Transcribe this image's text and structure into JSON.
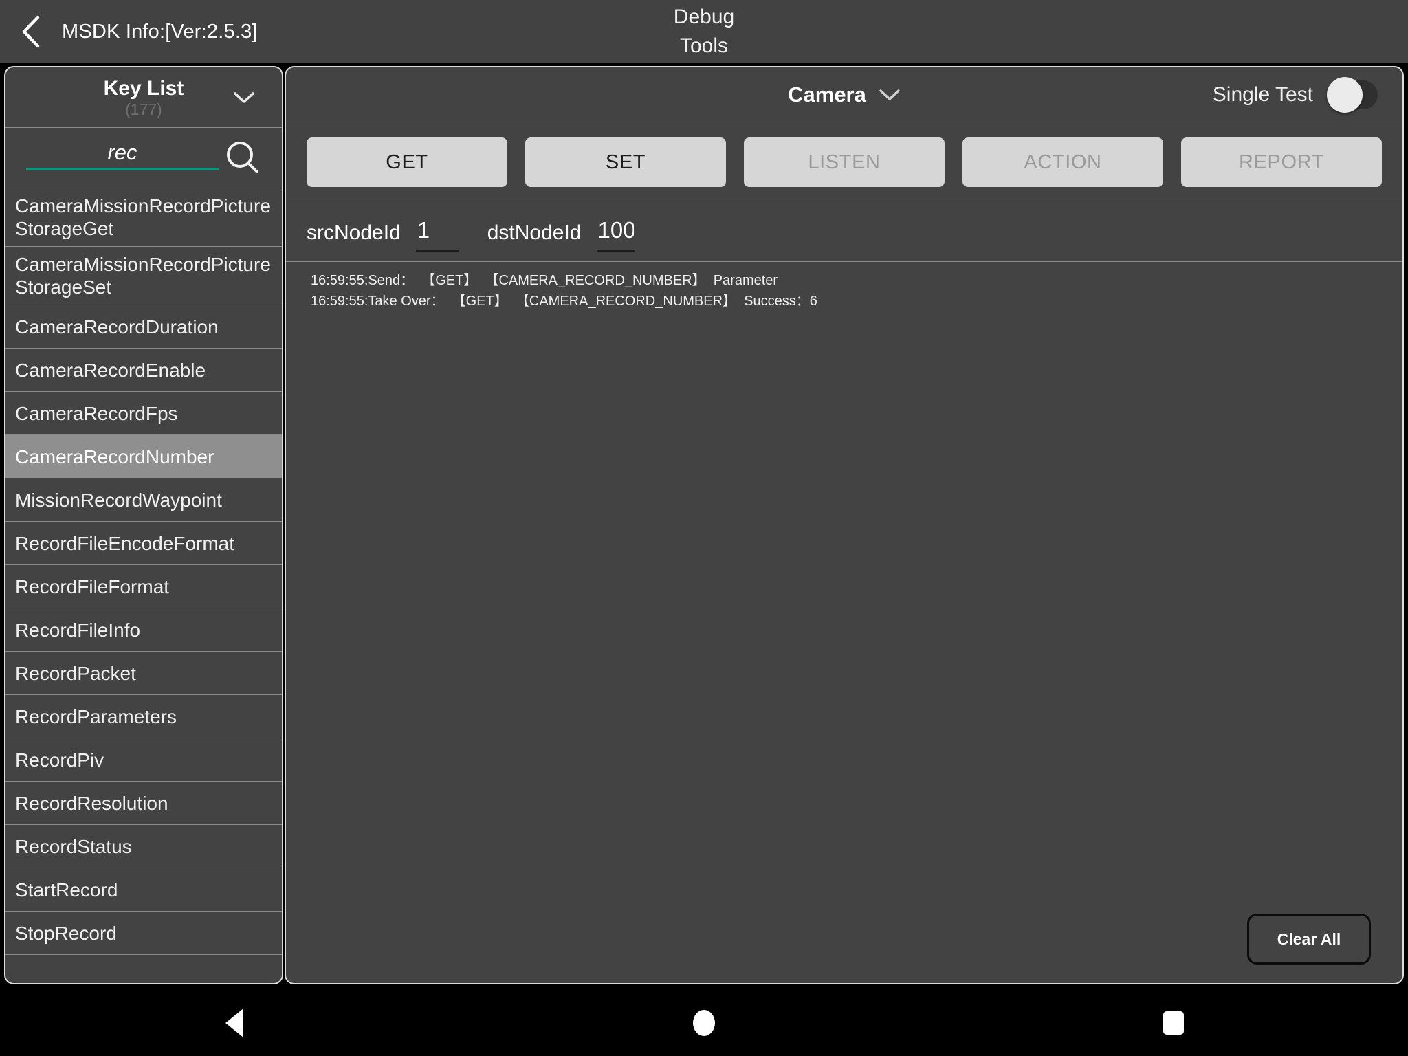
{
  "header": {
    "back_icon": "chevron-left-icon",
    "left_title": "MSDK Info:[Ver:2.5.3]",
    "title_line1": "Debug",
    "title_line2": "Tools"
  },
  "sidebar": {
    "title": "Key List",
    "count": "(177)",
    "caret_icon": "chevron-down-icon",
    "search": {
      "value": "rec",
      "placeholder": "",
      "icon": "search-icon",
      "underline_color": "#13927e"
    },
    "items": [
      {
        "label": "CameraMissionRecordPictureStorageGet",
        "selected": false
      },
      {
        "label": "CameraMissionRecordPictureStorageSet",
        "selected": false
      },
      {
        "label": "CameraRecordDuration",
        "selected": false
      },
      {
        "label": "CameraRecordEnable",
        "selected": false
      },
      {
        "label": "CameraRecordFps",
        "selected": false
      },
      {
        "label": "CameraRecordNumber",
        "selected": true
      },
      {
        "label": "MissionRecordWaypoint",
        "selected": false
      },
      {
        "label": "RecordFileEncodeFormat",
        "selected": false
      },
      {
        "label": "RecordFileFormat",
        "selected": false
      },
      {
        "label": "RecordFileInfo",
        "selected": false
      },
      {
        "label": "RecordPacket",
        "selected": false
      },
      {
        "label": "RecordParameters",
        "selected": false
      },
      {
        "label": "RecordPiv",
        "selected": false
      },
      {
        "label": "RecordResolution",
        "selected": false
      },
      {
        "label": "RecordStatus",
        "selected": false
      },
      {
        "label": "StartRecord",
        "selected": false
      },
      {
        "label": "StopRecord",
        "selected": false
      }
    ]
  },
  "main": {
    "module_select": {
      "label": "Camera",
      "caret_icon": "chevron-down-icon"
    },
    "single_test": {
      "label": "Single Test",
      "enabled": false
    },
    "buttons": [
      {
        "label": "GET",
        "disabled": false
      },
      {
        "label": "SET",
        "disabled": false
      },
      {
        "label": "LISTEN",
        "disabled": true
      },
      {
        "label": "ACTION",
        "disabled": true
      },
      {
        "label": "REPORT",
        "disabled": true
      }
    ],
    "node_fields": {
      "src_label": "srcNodeId",
      "src_value": "1",
      "dst_label": "dstNodeId",
      "dst_value": "100"
    },
    "log_lines": [
      "16:59:55:Send：  【GET】  【CAMERA_RECORD_NUMBER】  Parameter",
      "16:59:55:Take Over：  【GET】  【CAMERA_RECORD_NUMBER】  Success：6"
    ],
    "clear_all_label": "Clear All"
  },
  "navbar": {
    "back_icon": "triangle-back-icon",
    "home_icon": "circle-home-icon",
    "recents_icon": "square-recents-icon"
  }
}
